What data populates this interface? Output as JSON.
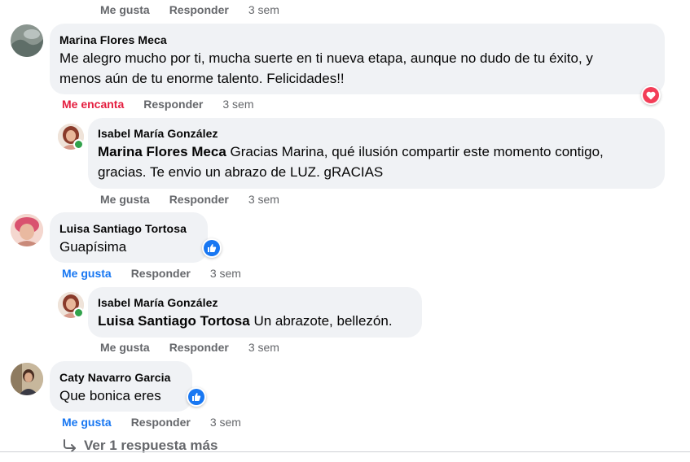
{
  "top_actions": {
    "like": "Me gusta",
    "reply": "Responder",
    "time": "3 sem"
  },
  "comments": [
    {
      "author": "Marina Flores Meca",
      "text_line1": "Me alegro mucho por ti, mucha suerte en ti nueva etapa, aunque no dudo de tu éxito, y",
      "text_line2": "menos aún de tu enorme talento. Felicidades!!",
      "reaction_label": "Me encanta",
      "reply_label": "Responder",
      "time": "3 sem",
      "reaction_icon": "heart-icon",
      "reply": {
        "author": "Isabel María González",
        "mention": "Marina Flores Meca",
        "text_line1": " Gracias Marina, qué ilusión compartir este momento contigo,",
        "text_line2": "gracias. Te envio un abrazo de LUZ. gRACIAS",
        "like_label": "Me gusta",
        "reply_label": "Responder",
        "time": "3 sem"
      }
    },
    {
      "author": "Luisa Santiago Tortosa",
      "text": "Guapísima",
      "reaction_label": "Me gusta",
      "reply_label": "Responder",
      "time": "3 sem",
      "reaction_icon": "thumbs-up-icon",
      "reply": {
        "author": "Isabel María González",
        "mention": "Luisa Santiago Tortosa",
        "text": " Un abrazote, bellezón.",
        "like_label": "Me gusta",
        "reply_label": "Responder",
        "time": "3 sem"
      }
    },
    {
      "author": "Caty Navarro Garcia",
      "text": "Que bonica eres",
      "reaction_label": "Me gusta",
      "reply_label": "Responder",
      "time": "3 sem",
      "reaction_icon": "thumbs-up-icon"
    }
  ],
  "more_replies": "Ver 1 respuesta más",
  "colors": {
    "bubble": "#f0f2f5",
    "muted": "#65676b",
    "like_blue": "#1877f2",
    "love_red": "#e41e3f",
    "online_green": "#31a24c"
  }
}
